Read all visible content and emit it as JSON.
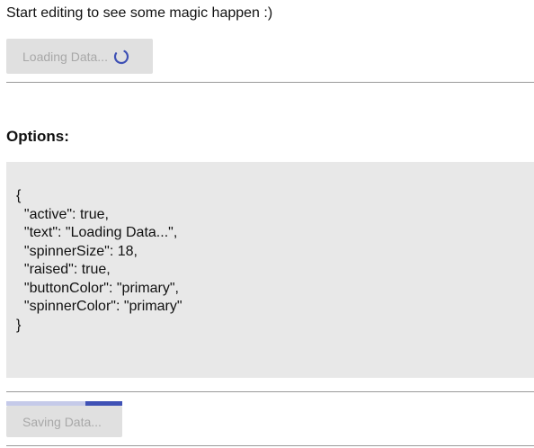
{
  "intro_text": "Start editing to see some magic happen :)",
  "loading_button": {
    "label": "Loading Data...",
    "spinner": "spinner-icon",
    "color": "#e0e0e0",
    "spinner_color": "#3f51b5"
  },
  "options": {
    "heading": "Options:",
    "code_lines": [
      "{",
      "  \"active\": true,",
      "  \"text\": \"Loading Data...\",",
      "  \"spinnerSize\": 18,",
      "  \"raised\": true,",
      "  \"buttonColor\": \"primary\",",
      "  \"spinnerColor\": \"primary\"",
      "}"
    ]
  },
  "saving_button": {
    "label": "Saving Data...",
    "progress_fraction_start": 0.68,
    "progress_fraction_end": 1.0,
    "track_color": "#c5cae9",
    "fill_color": "#3f51b5"
  }
}
